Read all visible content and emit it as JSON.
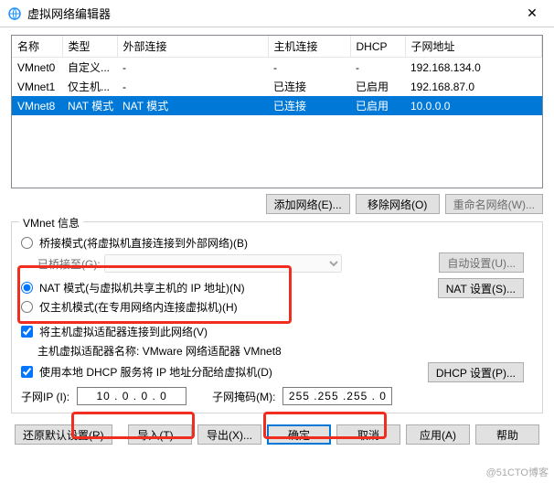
{
  "title": "虚拟网络编辑器",
  "columns": {
    "name": "名称",
    "type": "类型",
    "ext": "外部连接",
    "host": "主机连接",
    "dhcp": "DHCP",
    "subnet": "子网地址"
  },
  "rows": [
    {
      "name": "VMnet0",
      "type": "自定义...",
      "ext": "-",
      "host": "-",
      "dhcp": "-",
      "subnet": "192.168.134.0"
    },
    {
      "name": "VMnet1",
      "type": "仅主机...",
      "ext": "-",
      "host": "已连接",
      "dhcp": "已启用",
      "subnet": "192.168.87.0"
    },
    {
      "name": "VMnet8",
      "type": "NAT 模式",
      "ext": "NAT 模式",
      "host": "已连接",
      "dhcp": "已启用",
      "subnet": "10.0.0.0"
    }
  ],
  "buttons": {
    "add": "添加网络(E)...",
    "remove": "移除网络(O)",
    "rename": "重命名网络(W)...",
    "restore": "还原默认设置(R)",
    "import": "导入(T)...",
    "export": "导出(X)...",
    "ok": "确定",
    "cancel": "取消",
    "apply": "应用(A)",
    "help": "帮助",
    "autoset": "自动设置(U)...",
    "natset": "NAT 设置(S)...",
    "dhcpset": "DHCP 设置(P)..."
  },
  "group": {
    "title": "VMnet 信息",
    "bridge": "桥接模式(将虚拟机直接连接到外部网络)(B)",
    "bridge_to": "已桥接至(G):",
    "nat": "NAT 模式(与虚拟机共享主机的 IP 地址)(N)",
    "hostonly": "仅主机模式(在专用网络内连接虚拟机)(H)",
    "adapter": "将主机虚拟适配器连接到此网络(V)",
    "adapter_name_label": "主机虚拟适配器名称:",
    "adapter_name_value": "VMware 网络适配器 VMnet8",
    "dhcp": "使用本地 DHCP 服务将 IP 地址分配给虚拟机(D)",
    "subnet_ip_label": "子网IP (I):",
    "subnet_mask_label": "子网掩码(M):",
    "subnet_ip": "10 . 0 . 0 . 0",
    "subnet_mask": "255 .255 .255 . 0"
  },
  "watermark": "@51CTO博客"
}
